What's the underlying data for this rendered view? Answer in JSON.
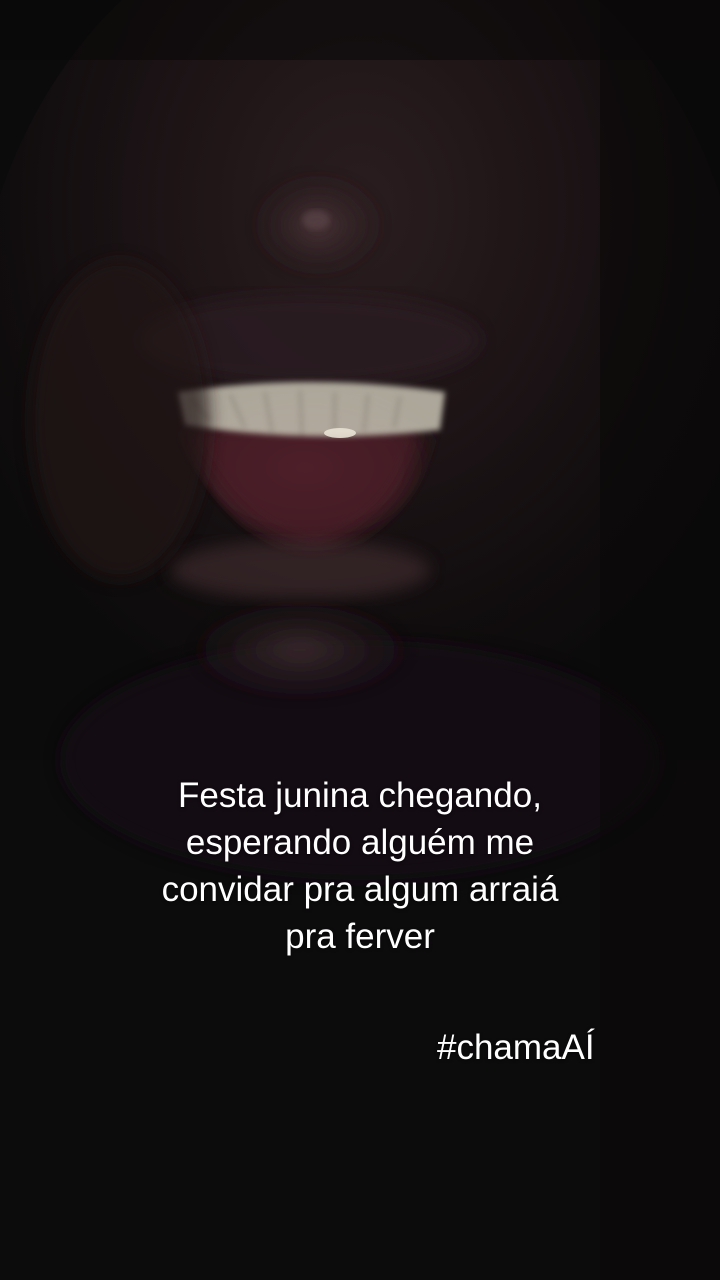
{
  "caption": {
    "lines": [
      "Festa junina chegando,",
      "esperando alguém me",
      "convidar pra algum arraiá",
      "pra ferver"
    ]
  },
  "hashtag": "#chamaAÍ",
  "photo": {
    "icon": "smiling-face-photo",
    "background_color": "#0c0b0b"
  }
}
